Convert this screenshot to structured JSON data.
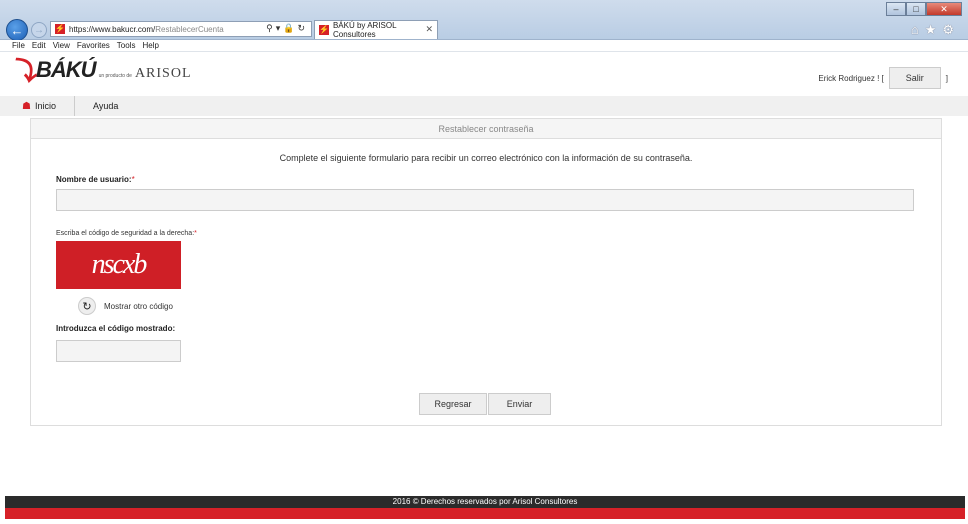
{
  "browser": {
    "url_host": "https://www.bakucr.com/",
    "url_path": "RestablecerCuenta",
    "tab_title": "BÁKÚ by ARISOL Consultores",
    "menu": [
      "File",
      "Edit",
      "View",
      "Favorites",
      "Tools",
      "Help"
    ]
  },
  "header": {
    "logo_text": "BÁKÚ",
    "logo_sub": "un producto de",
    "logo_company": "ARISOL",
    "user_name": "Erick Rodriguez ! [",
    "user_close": "]",
    "logout_label": "Salir"
  },
  "nav": {
    "home_label": "Inicio",
    "help_label": "Ayuda"
  },
  "panel": {
    "title": "Restablecer contraseña",
    "intro": "Complete el siguiente formulario para recibir un correo electrónico con la información de su contraseña.",
    "username_label": "Nombre de usuario:",
    "username_value": "",
    "required_mark": "*",
    "captcha_label": "Escriba el código de seguridad a la derecha:",
    "captcha_text": "nscxb",
    "refresh_label": "Mostrar otro código",
    "code_label": "Introduzca el código mostrado:",
    "code_value": "",
    "back_button": "Regresar",
    "submit_button": "Enviar"
  },
  "footer": {
    "text": "2016 © Derechos reservados por Arisol Consultores"
  },
  "colors": {
    "brand_red": "#d62128",
    "footer_dark": "#2b2b2b"
  }
}
